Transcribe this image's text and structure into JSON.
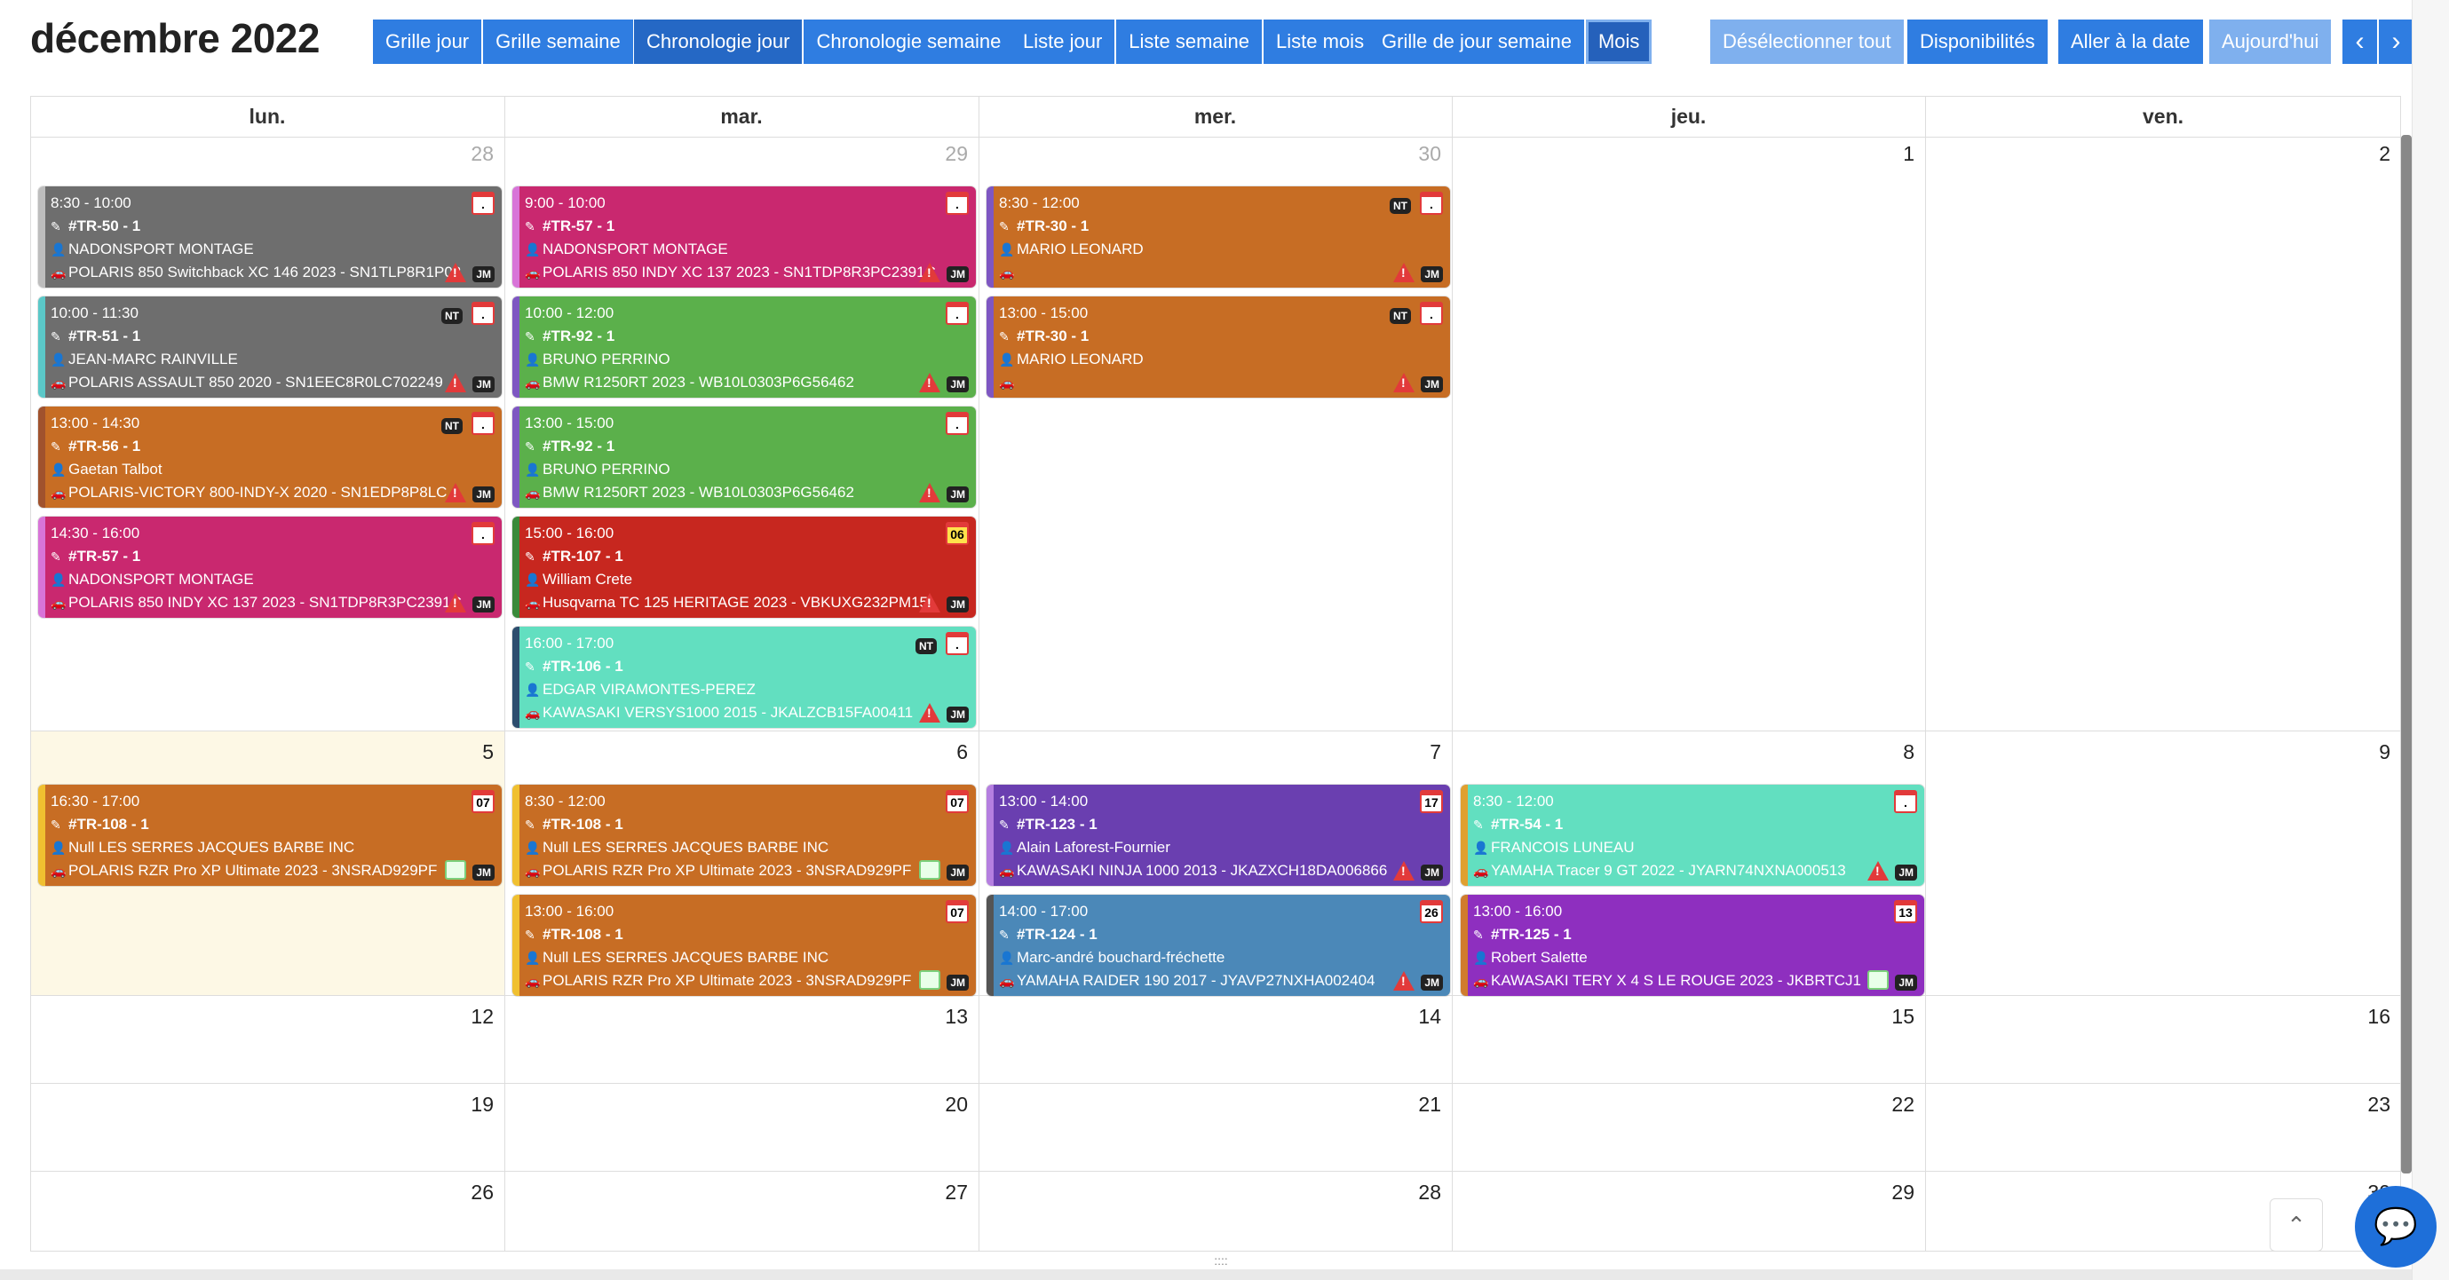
{
  "title": "décembre 2022",
  "toolbar": {
    "group1": [
      "Grille jour",
      "Grille semaine"
    ],
    "group2": [
      "Chronologie jour",
      "Chronologie semaine"
    ],
    "group3": [
      "Liste jour",
      "Liste semaine",
      "Liste mois"
    ],
    "group4": [
      "Grille de jour semaine",
      "Mois"
    ],
    "deselect": "Désélectionner tout",
    "availability": "Disponibilités",
    "goto": "Aller à la date",
    "today": "Aujourd'hui",
    "prev": "‹",
    "next": "›"
  },
  "days": [
    "lun.",
    "mar.",
    "mer.",
    "jeu.",
    "ven."
  ],
  "weeks": [
    [
      "28",
      "29",
      "30",
      "1",
      "2"
    ],
    [
      "5",
      "6",
      "7",
      "8",
      "9"
    ],
    [
      "12",
      "13",
      "14",
      "15",
      "16"
    ],
    [
      "19",
      "20",
      "21",
      "22",
      "23"
    ],
    [
      "26",
      "27",
      "28",
      "29",
      "30"
    ]
  ],
  "events": [
    {
      "time": "8:30 - 10:00",
      "ref": "#TR-50 - 1",
      "client": "NADONSPORT MONTAGE",
      "vehicle": "POLARIS 850 Switchback XC 146 2023 - SN1TLP8R1P02",
      "color": "#6e6e6e",
      "border": "#bdbdbd",
      "cal": "."
    },
    {
      "time": "10:00 - 11:30",
      "ref": "#TR-51 - 1",
      "client": "JEAN-MARC RAINVILLE",
      "vehicle": "POLARIS ASSAULT 850 2020 - SN1EEC8R0LC702249",
      "color": "#6e6e6e",
      "border": "#5bc8c8",
      "cal": ".",
      "nt": "NT"
    },
    {
      "time": "13:00 - 14:30",
      "ref": "#TR-56 - 1",
      "client": "Gaetan Talbot",
      "vehicle": "POLARIS-VICTORY 800-INDY-X 2020 - SN1EDP8P8LC",
      "color": "#c76d24",
      "border": "#a0522d",
      "cal": ".",
      "nt": "NT"
    },
    {
      "time": "14:30 - 16:00",
      "ref": "#TR-57 - 1",
      "client": "NADONSPORT MONTAGE",
      "vehicle": "POLARIS 850 INDY XC 137 2023 - SN1TDP8R3PC2391C",
      "color": "#c9286f",
      "border": "#d874d8",
      "cal": "."
    },
    {
      "time": "9:00 - 10:00",
      "ref": "#TR-57 - 1",
      "client": "NADONSPORT MONTAGE",
      "vehicle": "POLARIS 850 INDY XC 137 2023 - SN1TDP8R3PC2391C",
      "color": "#c9286f",
      "border": "#d874d8",
      "cal": "."
    },
    {
      "time": "10:00 - 12:00",
      "ref": "#TR-92 - 1",
      "client": "BRUNO PERRINO",
      "vehicle": "BMW R1250RT 2023 - WB10L0303P6G56462",
      "color": "#5bb04b",
      "border": "#7e57c2",
      "cal": "."
    },
    {
      "time": "13:00 - 15:00",
      "ref": "#TR-92 - 1",
      "client": "BRUNO PERRINO",
      "vehicle": "BMW R1250RT 2023 - WB10L0303P6G56462",
      "color": "#5bb04b",
      "border": "#7e57c2",
      "cal": "."
    },
    {
      "time": "15:00 - 16:00",
      "ref": "#TR-107 - 1",
      "client": "William Crete",
      "vehicle": "Husqvarna TC 125 HERITAGE 2023 - VBKUXG232PM15",
      "color": "#c7271f",
      "border": "#3a8a3a",
      "cal": "06"
    },
    {
      "time": "16:00 - 17:00",
      "ref": "#TR-106 - 1",
      "client": "EDGAR VIRAMONTES-PEREZ",
      "vehicle": "KAWASAKI VERSYS1000 2015 - JKALZCB15FA00411",
      "color": "#62dfc0",
      "border": "#2d4d6e",
      "cal": ".",
      "nt": "NT"
    },
    {
      "time": "8:30 - 12:00",
      "ref": "#TR-30 - 1",
      "client": "MARIO LEONARD",
      "vehicle": "",
      "color": "#c76d24",
      "border": "#7e57c2",
      "cal": ".",
      "nt": "NT"
    },
    {
      "time": "13:00 - 15:00",
      "ref": "#TR-30 - 1",
      "client": "MARIO LEONARD",
      "vehicle": "",
      "color": "#c76d24",
      "border": "#7e57c2",
      "cal": ".",
      "nt": "NT"
    },
    {
      "time": "16:30 - 17:00",
      "ref": "#TR-108 - 1",
      "client": "Null LES SERRES JACQUES BARBE INC",
      "vehicle": "POLARIS RZR Pro XP Ultimate 2023 - 3NSRAD929PF",
      "color": "#c76d24",
      "border": "#f0c030",
      "cal": "07"
    },
    {
      "time": "8:30 - 12:00",
      "ref": "#TR-108 - 1",
      "client": "Null LES SERRES JACQUES BARBE INC",
      "vehicle": "POLARIS RZR Pro XP Ultimate 2023 - 3NSRAD929PF",
      "color": "#c76d24",
      "border": "#f0c030",
      "cal": "07"
    },
    {
      "time": "13:00 - 16:00",
      "ref": "#TR-108 - 1",
      "client": "Null LES SERRES JACQUES BARBE INC",
      "vehicle": "POLARIS RZR Pro XP Ultimate 2023 - 3NSRAD929PF",
      "color": "#c76d24",
      "border": "#f0c030",
      "cal": "07"
    },
    {
      "time": "13:00 - 14:00",
      "ref": "#TR-123 - 1",
      "client": "Alain Laforest-Fournier",
      "vehicle": "KAWASAKI NINJA 1000 2013 - JKAZXCH18DA006866",
      "color": "#6a3fb0",
      "border": "#b57fe0",
      "cal": "17"
    },
    {
      "time": "14:00 - 17:00",
      "ref": "#TR-124 - 1",
      "client": "Marc-andré bouchard-fréchette",
      "vehicle": "YAMAHA RAIDER 190 2017 - JYAVP27NXHA002404",
      "color": "#4b88b8",
      "border": "#555555",
      "cal": "26"
    },
    {
      "time": "8:30 - 12:00",
      "ref": "#TR-54 - 1",
      "client": "FRANCOIS LUNEAU",
      "vehicle": "YAMAHA Tracer 9 GT 2022 - JYARN74NXNA000513",
      "color": "#62dfc0",
      "border": "#e0a030",
      "cal": "."
    },
    {
      "time": "13:00 - 16:00",
      "ref": "#TR-125 - 1",
      "client": "Robert Salette",
      "vehicle": "KAWASAKI TERY X 4 S LE ROUGE 2023 - JKBRTCJ1",
      "color": "#8e2fbf",
      "border": "#d07c2e",
      "cal": "13"
    }
  ],
  "badges": {
    "jm": "JM"
  },
  "scroll_up": "⌃",
  "chat": "💬"
}
